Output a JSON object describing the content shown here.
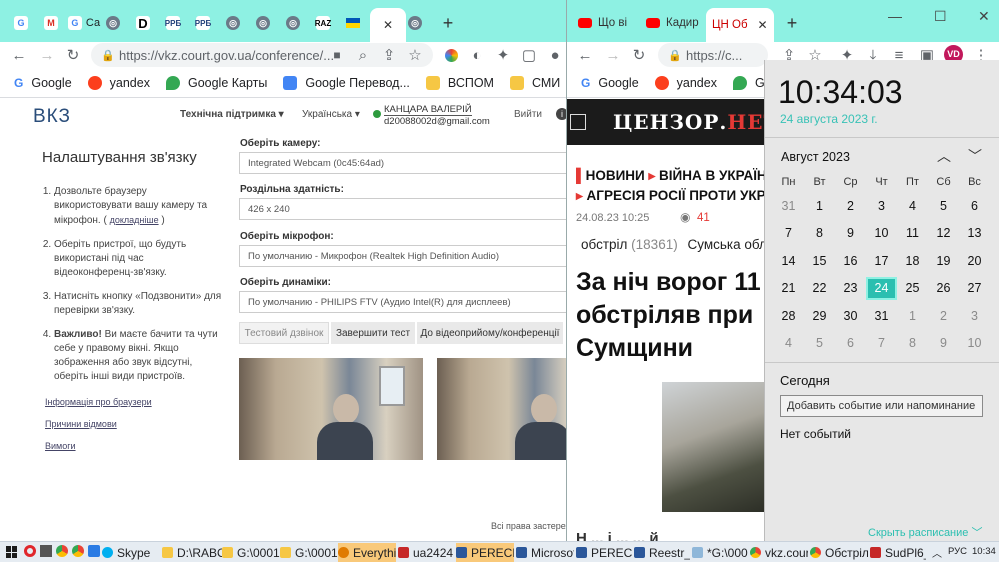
{
  "browser_left": {
    "tabs": [
      {
        "label": "",
        "icon": "google-icon"
      },
      {
        "label": "",
        "icon": "gmail-icon"
      },
      {
        "label": "Са",
        "icon": "google-icon"
      },
      {
        "label": "",
        "icon": "globe-icon"
      },
      {
        "label": "",
        "icon": "d-icon"
      },
      {
        "label": "",
        "icon": "rpb-icon"
      },
      {
        "label": "",
        "icon": "rpb-icon"
      },
      {
        "label": "",
        "icon": "globe-icon"
      },
      {
        "label": "",
        "icon": "globe-icon"
      },
      {
        "label": "",
        "icon": "globe-icon"
      },
      {
        "label": "",
        "icon": "raz-icon"
      },
      {
        "label": "",
        "icon": "ukraine-flag-icon"
      },
      {
        "label": "",
        "icon": "globe-icon"
      }
    ],
    "url": "https://vkz.court.gov.ua/conference/...",
    "bookmarks": [
      "Google",
      "yandex",
      "Google Карты",
      "Google Перевод...",
      "ВСПОМ",
      "СМИ"
    ]
  },
  "browser_right": {
    "tabs": [
      "Що ві",
      "Кадир",
      "ЦН Об"
    ],
    "url": "https://c...",
    "bookmarks": [
      "Google",
      "yandex",
      "Googl"
    ],
    "profile": "VD"
  },
  "vkz": {
    "logo": "ВКЗ",
    "support": "Технічна підтримка",
    "language": "Українська",
    "user_name": "КАНЦАРА ВАЛЕРІЙ",
    "user_email": "d20088002d@gmail.com",
    "logout": "Вийти",
    "title": "Налаштування зв'язку",
    "steps": [
      "Дозвольте браузеру використовувати вашу камеру та мікрофон. ( докладніше )",
      "Оберіть пристрої, що будуть використані під час відеоконференц-зв'язку.",
      "Натисніть кнопку «Подзвонити» для перевірки зв'язку.",
      "Важливо! Ви маєте бачити та чути себе у правому вікні. Якщо зображення або звук відсутні, оберіть інші види пристроїв."
    ],
    "step_link": "докладніше",
    "important_word": "Важливо!",
    "links": [
      "Інформація про браузери",
      "Причини відмови",
      "Вимоги"
    ],
    "camera_label": "Оберіть камеру:",
    "camera_value": "Integrated Webcam (0c45:64ad)",
    "resolution_label": "Роздільна здатність:",
    "resolution_value": "426 x 240",
    "mic_label": "Оберіть мікрофон:",
    "mic_value": "По умолчанию - Микрофон (Realtek High Definition Audio)",
    "speaker_label": "Оберіть динаміки:",
    "speaker_value": "По умолчанию - PHILIPS FTV (Аудио Intel(R) для дисплеев)",
    "btn_test_call": "Тестовий дзвінок",
    "btn_finish_test": "Завершити тест",
    "btn_to_conference": "До відеоприйому/конференції",
    "footer": "Всі права застереж"
  },
  "censor": {
    "logo_a": "ЦЕНЗОР.",
    "logo_b": "НЕТ",
    "nav1": "НОВИНИ",
    "nav2": "ВІЙНА В УКРАЇН",
    "nav3": "АГРЕСІЯ РОСІЇ ПРОТИ УКРА",
    "date": "24.08.23 10:25",
    "views": "41",
    "tag1": "обстріл",
    "tag1_count": "(18361)",
    "tag2": "Сумська обл",
    "headline": "За ніч ворог 11 обстріляв при Сумщини",
    "bottom_text": "Н ... і ... ... й"
  },
  "calendar": {
    "time": "10:34:03",
    "date": "24 августа 2023 г.",
    "month": "Август 2023",
    "weekdays": [
      "Пн",
      "Вт",
      "Ср",
      "Чт",
      "Пт",
      "Сб",
      "Вс"
    ],
    "weeks": [
      [
        "31",
        "1",
        "2",
        "3",
        "4",
        "5",
        "6"
      ],
      [
        "7",
        "8",
        "9",
        "10",
        "11",
        "12",
        "13"
      ],
      [
        "14",
        "15",
        "16",
        "17",
        "18",
        "19",
        "20"
      ],
      [
        "21",
        "22",
        "23",
        "24",
        "25",
        "26",
        "27"
      ],
      [
        "28",
        "29",
        "30",
        "31",
        "1",
        "2",
        "3"
      ],
      [
        "4",
        "5",
        "6",
        "7",
        "8",
        "9",
        "10"
      ]
    ],
    "today_label": "Сегодня",
    "add_event": "Добавить событие или напоминание",
    "no_events": "Нет событий",
    "hide_schedule": "Скрыть расписание"
  },
  "taskbar": {
    "items": [
      "Skype",
      "D:\\RABO...",
      "G:\\0001H...",
      "G:\\0001H...",
      "Everythin...",
      "ua2424 - ...",
      "PERECHE...",
      "Microsoft...",
      "PERECHE...",
      "Reestr_is...",
      "*G:\\0001...",
      "vkz.court...",
      "Обстріли...",
      "SudPl6_2..."
    ],
    "lang": "РУС",
    "clock": "10:34"
  }
}
